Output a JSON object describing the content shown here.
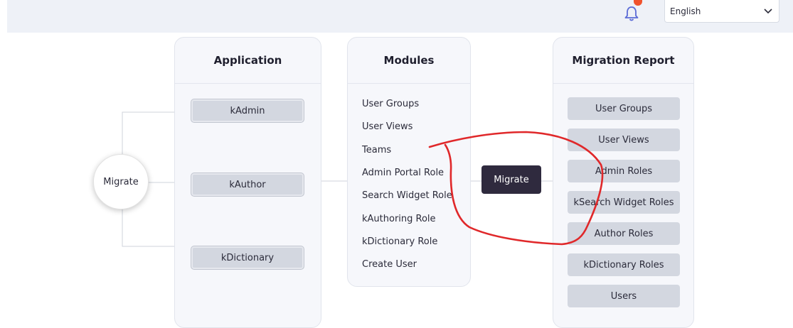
{
  "header": {
    "language_select": {
      "value": "English"
    },
    "notification_badge": {
      "count": "",
      "color": "#f0522d"
    }
  },
  "left_action": {
    "label": "Migrate"
  },
  "application_panel": {
    "title": "Application",
    "items": [
      "kAdmin",
      "kAuthor",
      "kDictionary"
    ]
  },
  "modules_panel": {
    "title": "Modules",
    "items": [
      "User Groups",
      "User Views",
      "Teams",
      "Admin Portal Role",
      "Search Widget Role",
      "kAuthoring Role",
      "kDictionary Role",
      "Create User"
    ]
  },
  "center_action": {
    "label": "Migrate",
    "color": "#2f2a3e"
  },
  "report_panel": {
    "title": "Migration Report",
    "items": [
      "User Groups",
      "User Views",
      "Admin Roles",
      "kSearch Widget Roles",
      "Author Roles",
      "kDictionary Roles",
      "Users"
    ]
  },
  "annotation": {
    "color": "#e0282a"
  }
}
